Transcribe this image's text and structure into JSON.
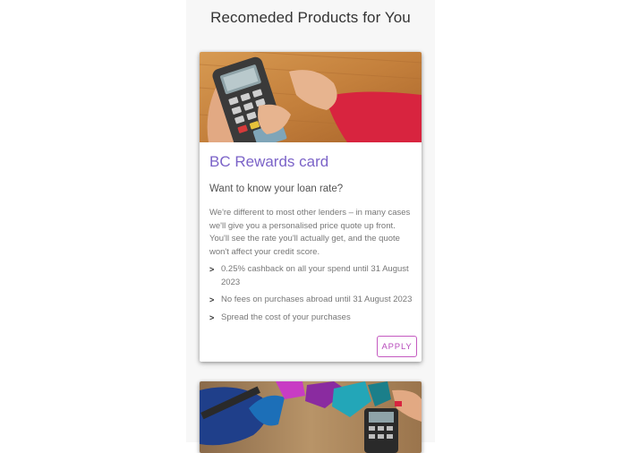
{
  "page": {
    "title": "Recomeded Products for You"
  },
  "products": [
    {
      "title": "BC Rewards card",
      "subtitle": "Want to know your loan rate?",
      "description": "We're different to most other lenders – in many cases we'll give you a personalised price quote up front. You'll see the rate you'll actually get, and the quote won't affect your credit score.",
      "features": [
        "0.25% cashback on all your spend until 31 August 2023",
        "No fees on purchases abroad until 31 August 2023",
        "Spread the cost of your purchases"
      ],
      "bullet": ">",
      "apply_label": "APPLY"
    }
  ],
  "colors": {
    "accent": "#7b63c8",
    "button": "#b84cbc",
    "column_background": "#f7f7f7"
  }
}
